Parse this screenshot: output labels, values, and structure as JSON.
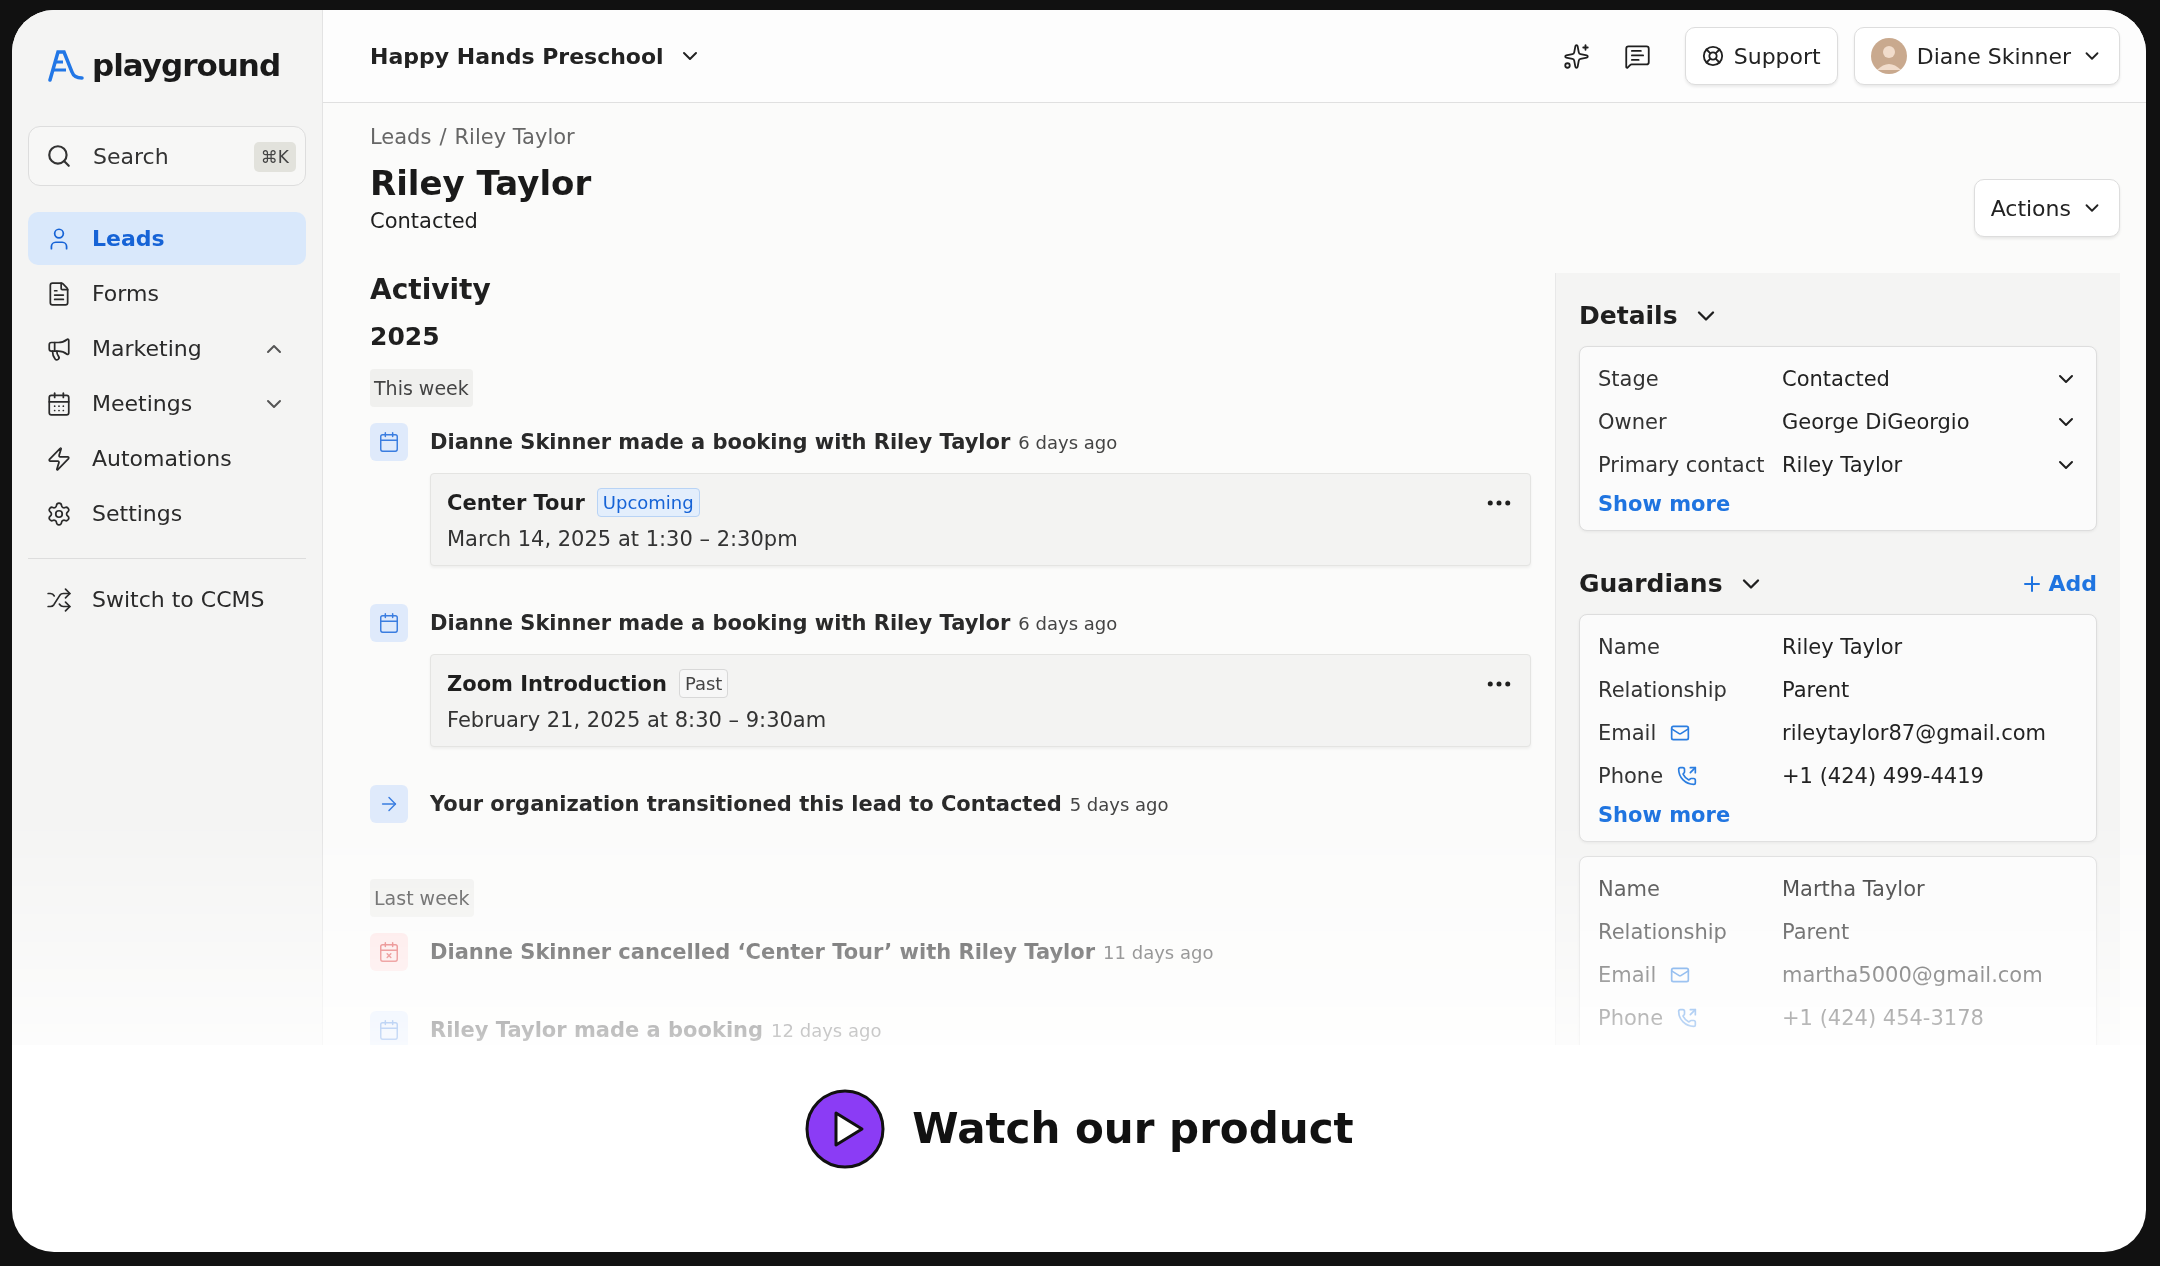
{
  "app": {
    "logo": "playground"
  },
  "search": {
    "placeholder": "Search",
    "shortcut": "⌘K"
  },
  "nav": [
    {
      "label": "Leads",
      "selected": true
    },
    {
      "label": "Forms",
      "selected": false
    },
    {
      "label": "Marketing",
      "selected": false,
      "expanded": true
    },
    {
      "label": "Meetings",
      "selected": false,
      "expanded": false
    },
    {
      "label": "Automations",
      "selected": false
    },
    {
      "label": "Settings",
      "selected": false
    }
  ],
  "switch_link": "Switch to CCMS",
  "topbar": {
    "school": "Happy Hands Preschool",
    "support": "Support",
    "user": "Diane Skinner"
  },
  "breadcrumb": {
    "items": [
      "Leads",
      "Riley Taylor"
    ],
    "separator": "/"
  },
  "lead": {
    "name": "Riley Taylor",
    "stage": "Contacted",
    "actions": "Actions"
  },
  "activity": {
    "title": "Activity",
    "year": "2025",
    "groups": [
      {
        "label": "This week",
        "items": [
          {
            "kind": "booking",
            "text": "Dianne Skinner made a booking with Riley Taylor",
            "time": "6 days ago",
            "event": {
              "title": "Center Tour",
              "status": "Upcoming",
              "upcoming": true,
              "when": "March 14, 2025 at 1:30 – 2:30pm"
            }
          },
          {
            "kind": "booking",
            "text": "Dianne Skinner made a booking with Riley Taylor",
            "time": "6 days ago",
            "event": {
              "title": "Zoom Introduction",
              "status": "Past",
              "upcoming": false,
              "when": "February 21, 2025 at 8:30 – 9:30am"
            }
          },
          {
            "kind": "transition",
            "text": "Your organization transitioned this lead to Contacted",
            "time": "5 days ago"
          }
        ]
      },
      {
        "label": "Last week",
        "items": [
          {
            "kind": "cancelled",
            "text": "Dianne Skinner cancelled ‘Center Tour’ with Riley Taylor",
            "time": "11 days ago"
          },
          {
            "kind": "booking",
            "text": "Riley Taylor made a booking",
            "time": "12 days ago"
          }
        ]
      }
    ]
  },
  "details": {
    "title": "Details",
    "rows": [
      {
        "label": "Stage",
        "value": "Contacted"
      },
      {
        "label": "Owner",
        "value": "George DiGeorgio"
      },
      {
        "label": "Primary contact",
        "value": "Riley Taylor"
      }
    ],
    "show_more": "Show more"
  },
  "guardians": {
    "title": "Guardians",
    "add": "Add",
    "cards": [
      {
        "rows": [
          {
            "kind": "text",
            "label": "Name",
            "value": "Riley Taylor"
          },
          {
            "kind": "text",
            "label": "Relationship",
            "value": "Parent"
          },
          {
            "kind": "email",
            "label": "Email",
            "value": "rileytaylor87@gmail.com"
          },
          {
            "kind": "phone",
            "label": "Phone",
            "value": "+1 (424) 499-4419"
          }
        ],
        "show_more": "Show more"
      },
      {
        "rows": [
          {
            "kind": "text",
            "label": "Name",
            "value": "Martha Taylor"
          },
          {
            "kind": "text",
            "label": "Relationship",
            "value": "Parent"
          },
          {
            "kind": "email",
            "label": "Email",
            "value": "martha5000@gmail.com"
          },
          {
            "kind": "phone",
            "label": "Phone",
            "value": "+1 (424) 454-3178"
          }
        ]
      }
    ]
  },
  "promo": "Watch our product"
}
